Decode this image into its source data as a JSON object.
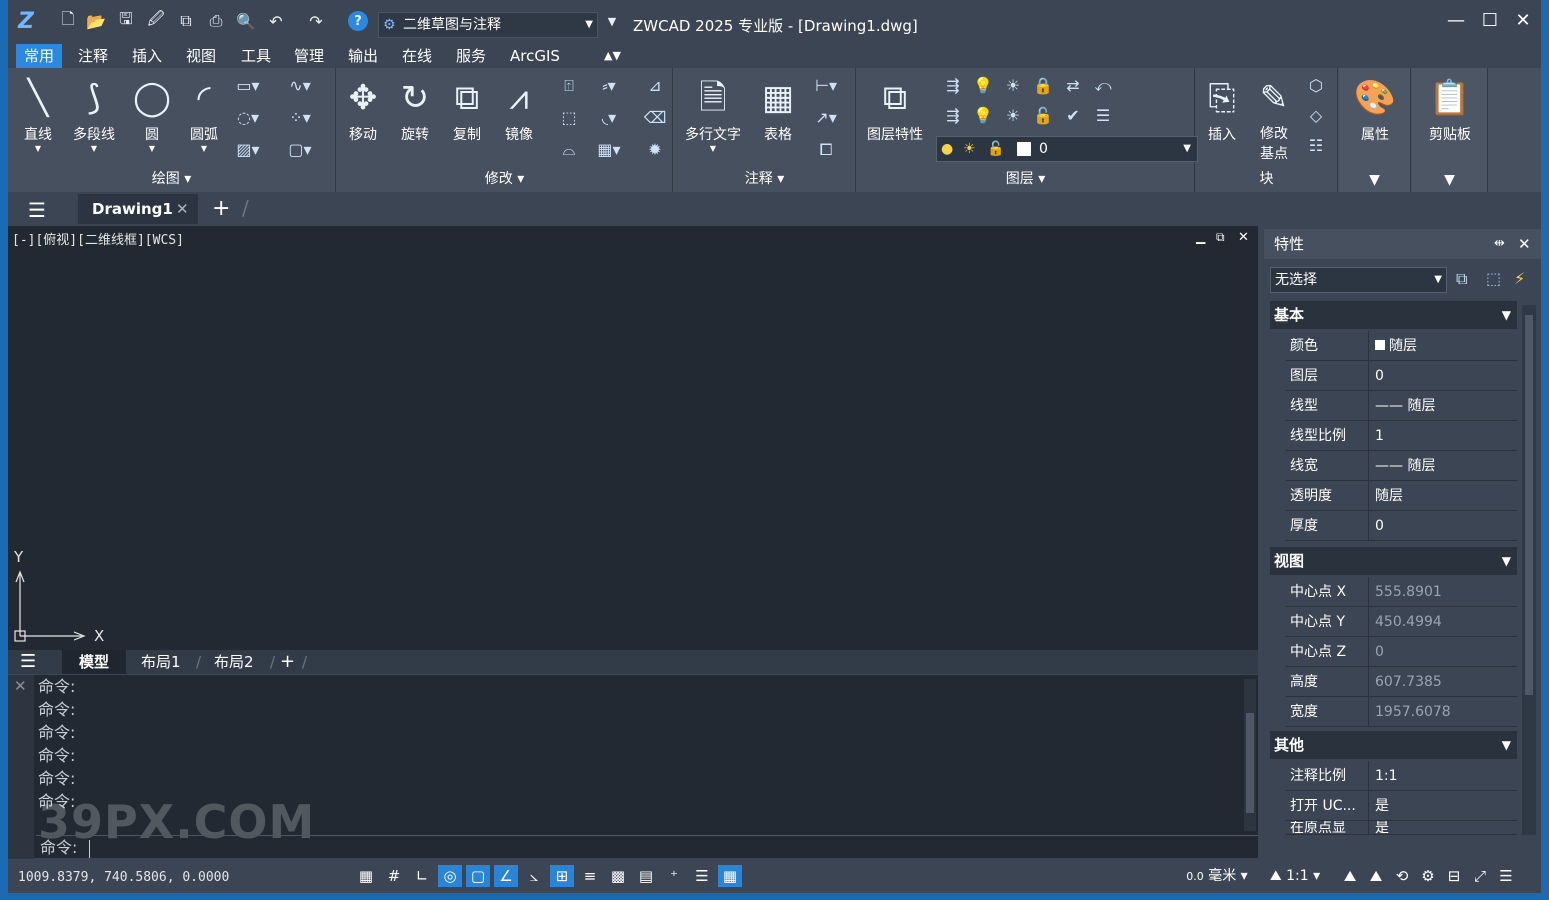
{
  "app": {
    "title": "ZWCAD 2025 专业版 - [Drawing1.dwg]",
    "workspace": "二维草图与注释",
    "accent_color": "#2b89e0"
  },
  "quick_access": [
    "new-icon",
    "open-icon",
    "save-icon",
    "saveas-icon",
    "copy-icon",
    "print-icon",
    "preview-icon",
    "undo-icon",
    "redo-icon",
    "help-icon"
  ],
  "menu": [
    "常用",
    "注释",
    "插入",
    "视图",
    "工具",
    "管理",
    "输出",
    "在线",
    "服务",
    "ArcGIS"
  ],
  "ribbon": {
    "draw": {
      "title": "绘图",
      "buttons": [
        "直线",
        "多段线",
        "圆",
        "圆弧"
      ]
    },
    "modify": {
      "title": "修改",
      "buttons": [
        "移动",
        "旋转",
        "复制",
        "镜像"
      ]
    },
    "annotate": {
      "title": "注释",
      "buttons": [
        "多行文字",
        "表格"
      ]
    },
    "layers": {
      "title": "图层",
      "buttons": [
        "图层特性"
      ],
      "current_layer": "0"
    },
    "block": {
      "title": "块",
      "buttons": [
        "插入",
        "修改\n基点"
      ]
    },
    "properties": {
      "label": "属性"
    },
    "clipboard": {
      "label": "剪贴板"
    }
  },
  "doc_tab": "Drawing1",
  "viewport_label": "[-][俯视][二维线框][WCS]",
  "axes": {
    "x": "X",
    "y": "Y"
  },
  "layout_tabs": [
    "模型",
    "布局1",
    "布局2"
  ],
  "command_history": [
    "命令:",
    "命令:",
    "命令:",
    "命令:",
    "命令:",
    "命令:"
  ],
  "command_prompt": "命令:",
  "watermark": "39PX.COM",
  "status": {
    "coords": "1009.8379, 740.5806, 0.0000",
    "units": "毫米",
    "scale": "1:1"
  },
  "properties_palette": {
    "title": "特性",
    "selection": "无选择",
    "sections": {
      "basic": {
        "title": "基本",
        "rows": [
          [
            "颜色",
            "随层"
          ],
          [
            "图层",
            "0"
          ],
          [
            "线型",
            "—— 随层"
          ],
          [
            "线型比例",
            "1"
          ],
          [
            "线宽",
            "—— 随层"
          ],
          [
            "透明度",
            "随层"
          ],
          [
            "厚度",
            "0"
          ]
        ]
      },
      "view": {
        "title": "视图",
        "rows": [
          [
            "中心点 X",
            "555.8901"
          ],
          [
            "中心点 Y",
            "450.4994"
          ],
          [
            "中心点 Z",
            "0"
          ],
          [
            "高度",
            "607.7385"
          ],
          [
            "宽度",
            "1957.6078"
          ]
        ]
      },
      "other": {
        "title": "其他",
        "rows": [
          [
            "注释比例",
            "1:1"
          ],
          [
            "打开 UC...",
            "是"
          ],
          [
            "在原点显",
            "是"
          ]
        ]
      }
    }
  }
}
